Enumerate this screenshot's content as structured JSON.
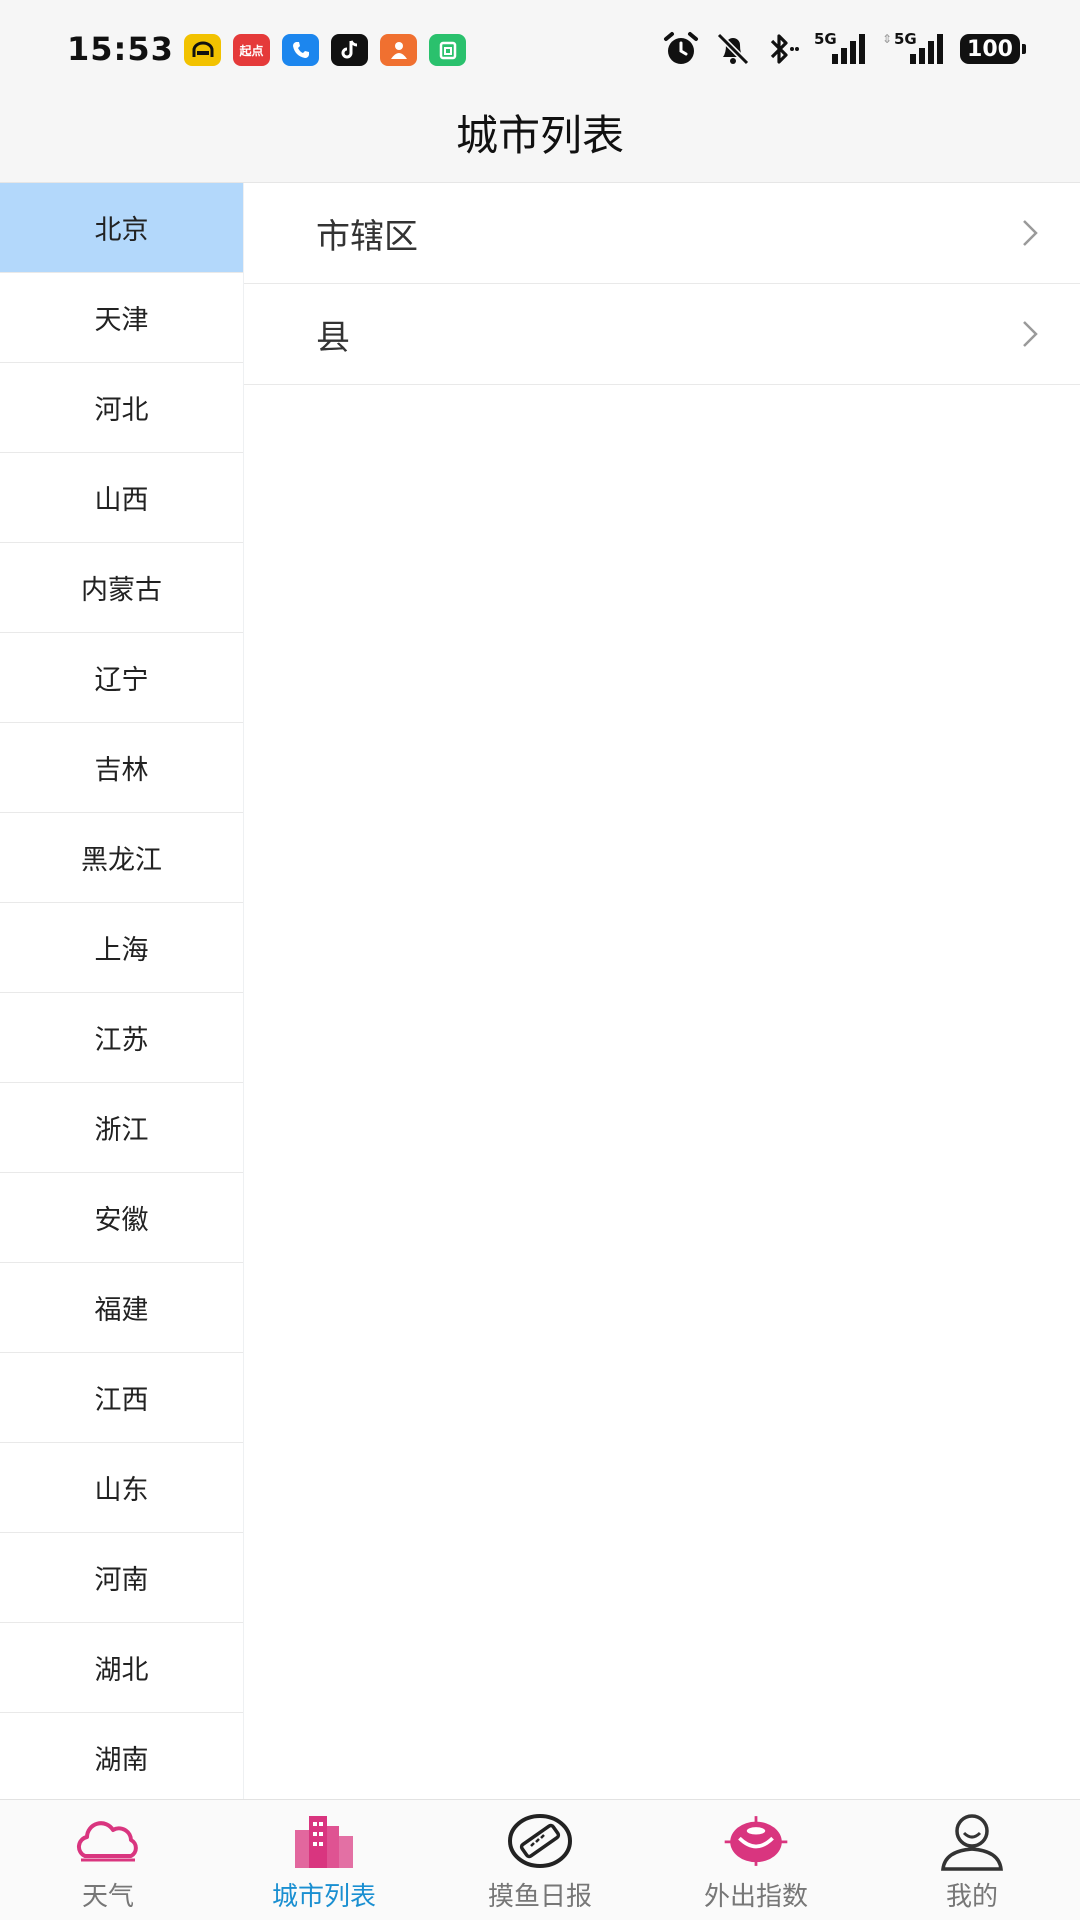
{
  "status_bar": {
    "time": "15:53",
    "notification_icons": [
      {
        "name": "car-app-icon",
        "color": "#f2c200",
        "glyph": "⌒"
      },
      {
        "name": "qidian-app-icon",
        "color": "#e53a3a",
        "glyph": "起点"
      },
      {
        "name": "phone-app-icon",
        "color": "#1c86ee",
        "glyph": "✆"
      },
      {
        "name": "tiktok-app-icon",
        "color": "#111111",
        "glyph": "♪"
      },
      {
        "name": "taobao-app-icon",
        "color": "#f07030",
        "glyph": "☺"
      },
      {
        "name": "calendar-app-icon",
        "color": "#2ac16d",
        "glyph": "▣"
      }
    ],
    "signal_1": "5G",
    "signal_2": "5G",
    "battery": "100"
  },
  "header": {
    "title": "城市列表"
  },
  "provinces": [
    {
      "label": "北京",
      "selected": true
    },
    {
      "label": "天津",
      "selected": false
    },
    {
      "label": "河北",
      "selected": false
    },
    {
      "label": "山西",
      "selected": false
    },
    {
      "label": "内蒙古",
      "selected": false
    },
    {
      "label": "辽宁",
      "selected": false
    },
    {
      "label": "吉林",
      "selected": false
    },
    {
      "label": "黑龙江",
      "selected": false
    },
    {
      "label": "上海",
      "selected": false
    },
    {
      "label": "江苏",
      "selected": false
    },
    {
      "label": "浙江",
      "selected": false
    },
    {
      "label": "安徽",
      "selected": false
    },
    {
      "label": "福建",
      "selected": false
    },
    {
      "label": "江西",
      "selected": false
    },
    {
      "label": "山东",
      "selected": false
    },
    {
      "label": "河南",
      "selected": false
    },
    {
      "label": "湖北",
      "selected": false
    },
    {
      "label": "湖南",
      "selected": false
    }
  ],
  "cities": [
    {
      "label": "市辖区"
    },
    {
      "label": "县"
    }
  ],
  "tabs": [
    {
      "label": "天气",
      "icon": "cloud-icon",
      "active": false
    },
    {
      "label": "城市列表",
      "icon": "city-buildings-icon",
      "active": true
    },
    {
      "label": "摸鱼日报",
      "icon": "ruler-badge-icon",
      "active": false
    },
    {
      "label": "外出指数",
      "icon": "outdoor-index-icon",
      "active": false
    },
    {
      "label": "我的",
      "icon": "user-profile-icon",
      "active": false
    }
  ],
  "colors": {
    "selected_province_bg": "#b3d8fb",
    "active_tab_text": "#1a8fd1",
    "icon_accent": "#d9357f"
  }
}
